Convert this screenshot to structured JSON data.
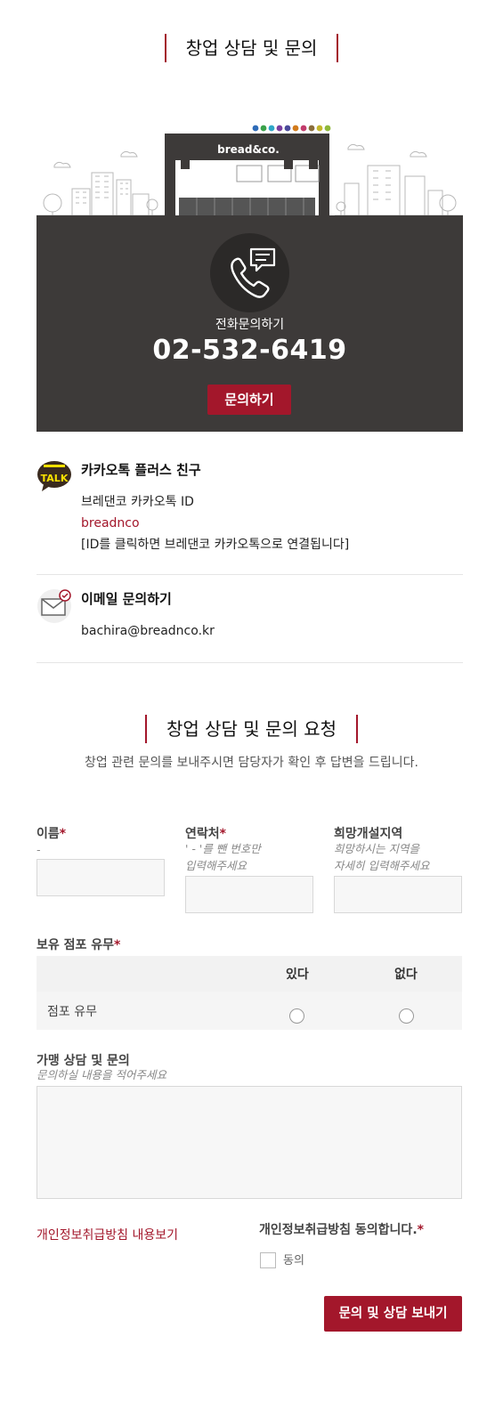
{
  "header": {
    "title": "창업 상담 및 문의"
  },
  "store_illustration": {
    "sign": "bread&co."
  },
  "phone": {
    "label": "전화문의하기",
    "number": "02-532-6419",
    "button": "문의하기"
  },
  "kakao": {
    "icon_text": "TALK",
    "title": "카카오톡 플러스 친구",
    "id_label": "브레댄코 카카오톡 ID",
    "id_value": "breadnco",
    "note": "[ID를 클릭하면 브레댄코 카카오톡으로 연결됩니다]"
  },
  "email": {
    "title": "이메일 문의하기",
    "address": "bachira@breadnco.kr"
  },
  "request": {
    "title": "창업 상담 및 문의 요청",
    "subtitle": "창업 관련 문의를 보내주시면 담당자가 확인 후 답변을 드립니다."
  },
  "form": {
    "name": {
      "label": "이름",
      "required": "*",
      "hint": "-"
    },
    "contact": {
      "label": "연락처",
      "required": "*",
      "hint1": "' - '를 뺀 번호만",
      "hint2": "입력해주세요"
    },
    "region": {
      "label": "희망개설지역",
      "hint1": "희망하시는 지역을",
      "hint2": "자세히 입력해주세요"
    },
    "store": {
      "label": "보유 점포 유무",
      "required": "*",
      "col_yes": "있다",
      "col_no": "없다",
      "row_label": "점포 유무"
    },
    "inquiry": {
      "label": "가맹 상담 및 문의",
      "hint": "문의하실 내용을 적어주세요"
    },
    "privacy_link": "개인정보취급방침 내용보기",
    "agree": {
      "label": "개인정보취급방침 동의합니다.",
      "required": "*",
      "option": "동의"
    },
    "submit": "문의 및 상담 보내기"
  },
  "colors": {
    "accent": "#a3172b",
    "panel": "#3d3a39",
    "kakao_yellow": "#f9e000"
  }
}
